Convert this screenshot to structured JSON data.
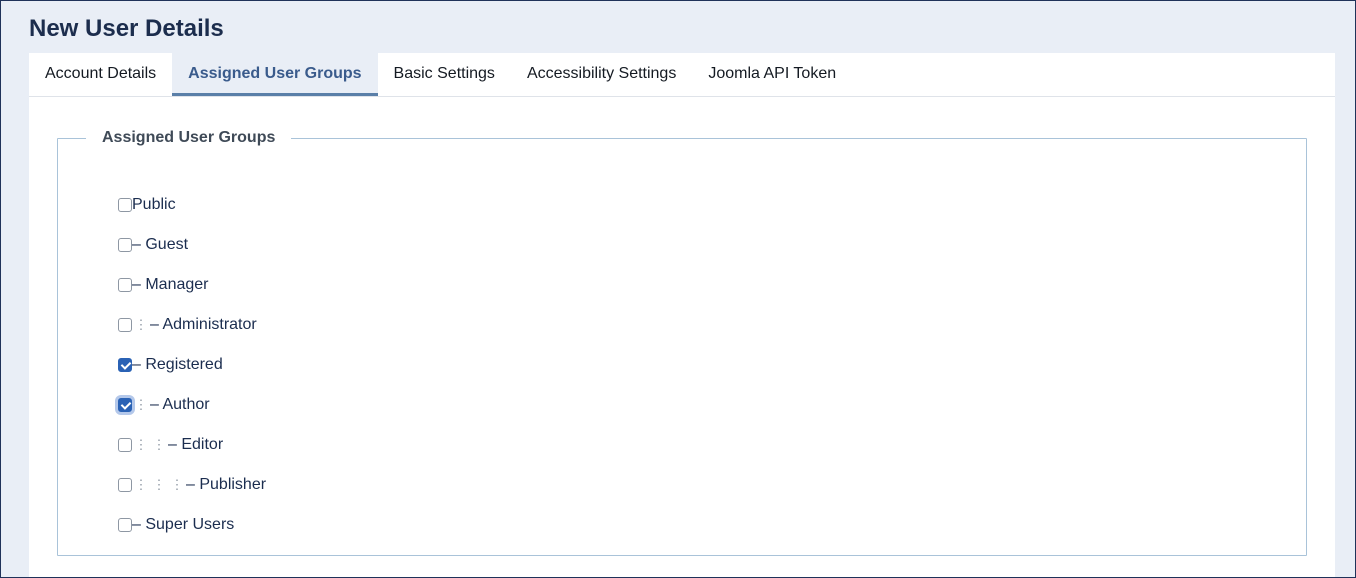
{
  "page": {
    "title": "New User Details"
  },
  "tabs": [
    {
      "label": "Account Details",
      "active": false
    },
    {
      "label": "Assigned User Groups",
      "active": true
    },
    {
      "label": "Basic Settings",
      "active": false
    },
    {
      "label": "Accessibility Settings",
      "active": false
    },
    {
      "label": "Joomla API Token",
      "active": false
    }
  ],
  "fieldset": {
    "legend": "Assigned User Groups",
    "groups": [
      {
        "label": "Public",
        "level": 0,
        "checked": false
      },
      {
        "label": "– Guest",
        "level": 1,
        "checked": false
      },
      {
        "label": "– Manager",
        "level": 1,
        "checked": false
      },
      {
        "label": "– Administrator",
        "level": 2,
        "checked": false
      },
      {
        "label": "– Registered",
        "level": 1,
        "checked": true
      },
      {
        "label": "– Author",
        "level": 2,
        "checked": true,
        "focused": true
      },
      {
        "label": "– Editor",
        "level": 3,
        "checked": false
      },
      {
        "label": "– Publisher",
        "level": 4,
        "checked": false
      },
      {
        "label": "– Super Users",
        "level": 1,
        "checked": false
      }
    ]
  },
  "colors": {
    "accent": "#2a62b5",
    "active_tab_text": "#3a5b8c",
    "active_tab_bg": "#e9eef6"
  }
}
